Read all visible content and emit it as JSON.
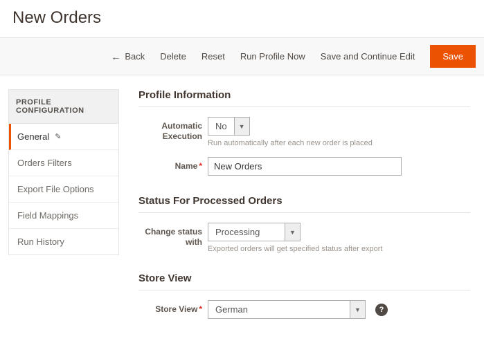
{
  "page_title": "New Orders",
  "toolbar": {
    "back": "Back",
    "delete": "Delete",
    "reset": "Reset",
    "run": "Run Profile Now",
    "save_continue": "Save and Continue Edit",
    "save": "Save"
  },
  "sidebar": {
    "title": "PROFILE CONFIGURATION",
    "items": [
      {
        "label": "General",
        "active": true
      },
      {
        "label": "Orders Filters",
        "active": false
      },
      {
        "label": "Export File Options",
        "active": false
      },
      {
        "label": "Field Mappings",
        "active": false
      },
      {
        "label": "Run History",
        "active": false
      }
    ]
  },
  "sections": {
    "profile_info": {
      "title": "Profile Information",
      "auto_exec_label": "Automatic Execution",
      "auto_exec_value": "No",
      "auto_exec_hint": "Run automatically after each new order is placed",
      "name_label": "Name",
      "name_value": "New Orders"
    },
    "status": {
      "title": "Status For Processed Orders",
      "change_label": "Change status with",
      "change_value": "Processing",
      "change_hint": "Exported orders will get specified status after export"
    },
    "store": {
      "title": "Store View",
      "label": "Store View",
      "value": "German"
    }
  }
}
